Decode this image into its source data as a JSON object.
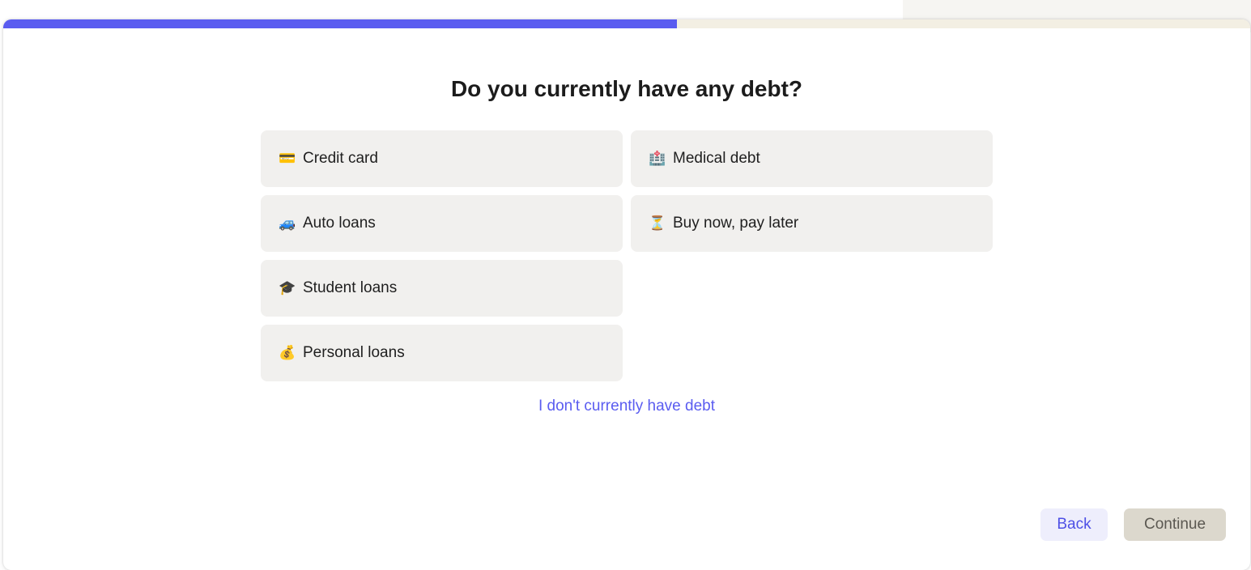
{
  "progress": {
    "fraction": 0.54,
    "fill_color": "#5a5cf0",
    "track_color": "#f3efe3"
  },
  "question": {
    "title": "Do you currently have any debt?"
  },
  "options": [
    {
      "label": "Credit card",
      "icon": "credit-card-icon",
      "glyph": "💳"
    },
    {
      "label": "Medical debt",
      "icon": "medical-record-icon",
      "glyph": "🏥"
    },
    {
      "label": "Auto loans",
      "icon": "car-icon",
      "glyph": "🚙"
    },
    {
      "label": "Buy now, pay later",
      "icon": "hourglass-icon",
      "glyph": "⏳"
    },
    {
      "label": "Student loans",
      "icon": "graduation-cap-icon",
      "glyph": "🎓"
    },
    {
      "label": "Personal loans",
      "icon": "money-bag-icon",
      "glyph": "💰"
    }
  ],
  "no_debt_link": "I don't currently have debt",
  "buttons": {
    "back": "Back",
    "continue": "Continue"
  },
  "colors": {
    "accent": "#5a5cf0",
    "option_bg": "#f1f0ee",
    "continue_bg": "#dcd8cd"
  }
}
